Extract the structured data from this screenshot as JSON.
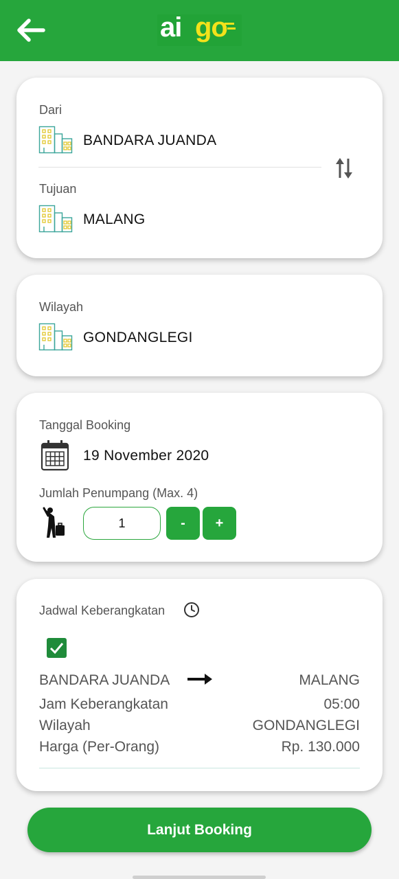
{
  "header": {
    "back_icon": "arrow-left-icon",
    "logo_part1": "ai",
    "logo_part2": "go"
  },
  "route": {
    "from_label": "Dari",
    "from_value": "BANDARA JUANDA",
    "to_label": "Tujuan",
    "to_value": "MALANG",
    "location_icon": "buildings-icon",
    "swap_icon": "swap-vertical-icon"
  },
  "region": {
    "label": "Wilayah",
    "value": "GONDANGLEGI"
  },
  "booking": {
    "date_label": "Tanggal Booking",
    "date_value": "19 November 2020",
    "calendar_icon": "calendar-icon",
    "passenger_label": "Jumlah Penumpang (Max. 4)",
    "passenger_icon": "traveler-icon",
    "passenger_count": "1",
    "minus_label": "-",
    "plus_label": "+"
  },
  "schedule": {
    "title": "Jadwal Keberangkatan",
    "clock_icon": "clock-icon",
    "checked": true,
    "origin": "BANDARA JUANDA",
    "destination": "MALANG",
    "rows": [
      {
        "label": "Jam Keberangkatan",
        "value": "05:00"
      },
      {
        "label": "Wilayah",
        "value": "GONDANGLEGI"
      },
      {
        "label": "Harga (Per-Orang)",
        "value": "Rp. 130.000"
      }
    ]
  },
  "cta": {
    "label": "Lanjut Booking"
  },
  "colors": {
    "primary_green": "#26a63c",
    "logo_yellow": "#f3e21b",
    "checkbox_green": "#1f8b3a"
  }
}
